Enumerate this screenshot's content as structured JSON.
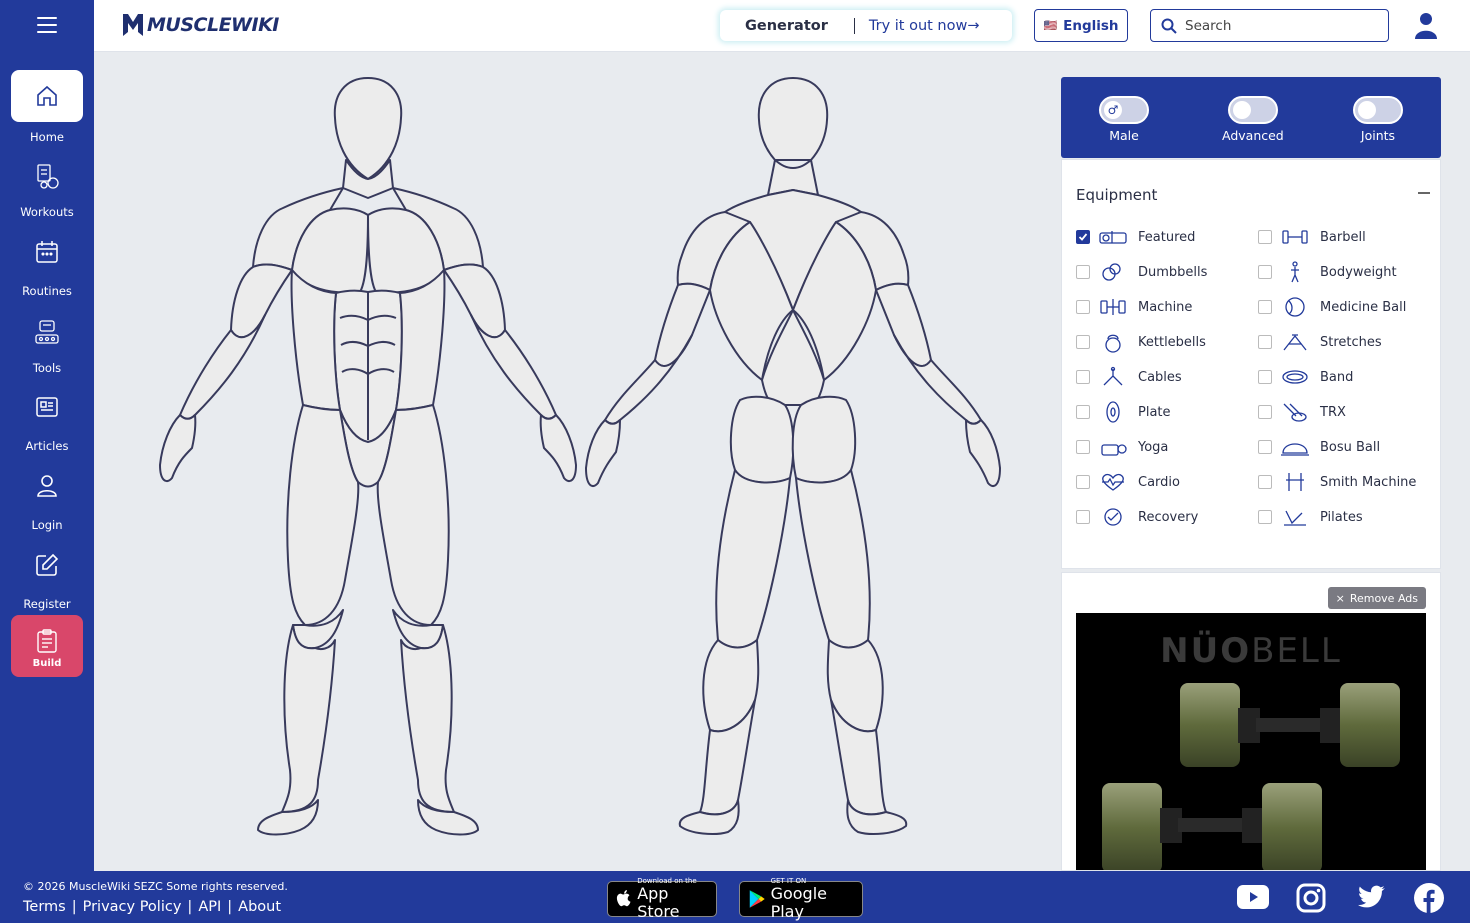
{
  "app": {
    "logo_text": "MUSCLEWIKI"
  },
  "sidebar": {
    "items": [
      {
        "label": "Home",
        "icon": "home-icon",
        "active": true
      },
      {
        "label": "Workouts",
        "icon": "workouts-icon"
      },
      {
        "label": "Routines",
        "icon": "calendar-icon"
      },
      {
        "label": "Tools",
        "icon": "tools-icon"
      },
      {
        "label": "Articles",
        "icon": "articles-icon"
      },
      {
        "label": "Login",
        "icon": "user-icon"
      },
      {
        "label": "Register",
        "icon": "edit-icon"
      },
      {
        "label": "Build",
        "icon": "clipboard-icon",
        "highlight": "#d9476a"
      }
    ]
  },
  "header": {
    "generator_label": "Generator",
    "generator_cta": "Try it out now→",
    "language": "English",
    "search_placeholder": "Search"
  },
  "toggles": [
    {
      "label": "Male",
      "symbol": "♂",
      "on": false
    },
    {
      "label": "Advanced",
      "on": false
    },
    {
      "label": "Joints",
      "on": false
    }
  ],
  "equipment": {
    "title": "Equipment",
    "items": [
      {
        "label": "Featured",
        "checked": true,
        "icon": "featured-icon"
      },
      {
        "label": "Barbell",
        "checked": false,
        "icon": "barbell-icon"
      },
      {
        "label": "Dumbbells",
        "checked": false,
        "icon": "dumbbells-icon"
      },
      {
        "label": "Bodyweight",
        "checked": false,
        "icon": "bodyweight-icon"
      },
      {
        "label": "Machine",
        "checked": false,
        "icon": "machine-icon"
      },
      {
        "label": "Medicine Ball",
        "checked": false,
        "icon": "medicine-ball-icon"
      },
      {
        "label": "Kettlebells",
        "checked": false,
        "icon": "kettlebell-icon"
      },
      {
        "label": "Stretches",
        "checked": false,
        "icon": "stretches-icon"
      },
      {
        "label": "Cables",
        "checked": false,
        "icon": "cables-icon"
      },
      {
        "label": "Band",
        "checked": false,
        "icon": "band-icon"
      },
      {
        "label": "Plate",
        "checked": false,
        "icon": "plate-icon"
      },
      {
        "label": "TRX",
        "checked": false,
        "icon": "trx-icon"
      },
      {
        "label": "Yoga",
        "checked": false,
        "icon": "yoga-icon"
      },
      {
        "label": "Bosu Ball",
        "checked": false,
        "icon": "bosu-ball-icon"
      },
      {
        "label": "Cardio",
        "checked": false,
        "icon": "cardio-icon"
      },
      {
        "label": "Smith Machine",
        "checked": false,
        "icon": "smith-machine-icon"
      },
      {
        "label": "Recovery",
        "checked": false,
        "icon": "recovery-icon"
      },
      {
        "label": "Pilates",
        "checked": false,
        "icon": "pilates-icon"
      }
    ]
  },
  "ad": {
    "remove_label": "Remove Ads",
    "brand_bold": "NÜO",
    "brand_light": "BELL"
  },
  "footer": {
    "copyright": "© 2026 MuscleWiki SEZC Some rights reserved.",
    "links": [
      "Terms",
      "Privacy Policy",
      "API",
      "About"
    ],
    "app_store_small": "Download on the",
    "app_store_big": "App Store",
    "play_small": "GET IT ON",
    "play_big": "Google Play",
    "social": [
      "youtube-icon",
      "instagram-icon",
      "twitter-icon",
      "facebook-icon"
    ]
  },
  "colors": {
    "brand_blue": "#223a9b",
    "build_pink": "#d9476a",
    "canvas_bg": "#e8ebef",
    "body_fill": "#ececec",
    "body_stroke": "#383a5c"
  }
}
